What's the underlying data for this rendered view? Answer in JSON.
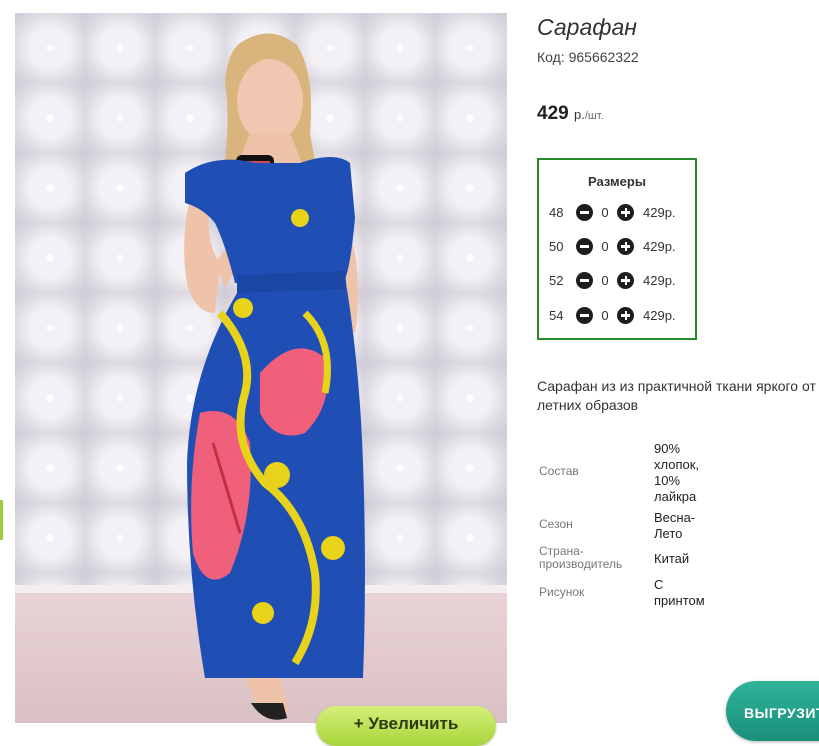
{
  "product": {
    "title": "Сарафан",
    "code": "Код: 965662322",
    "price_value": "429",
    "price_unit": "р.",
    "price_per": "/шт."
  },
  "sizes": {
    "title": "Размеры",
    "rows": [
      {
        "size": "48",
        "qty": "0",
        "price": "429р."
      },
      {
        "size": "50",
        "qty": "0",
        "price": "429р."
      },
      {
        "size": "52",
        "qty": "0",
        "price": "429р."
      },
      {
        "size": "54",
        "qty": "0",
        "price": "429р."
      }
    ]
  },
  "description": {
    "line1": "Сарафан из из практичной ткани яркого от",
    "line2": "летних образов"
  },
  "properties": [
    {
      "label": "Состав",
      "value": "90% хлопок, 10% лайкра"
    },
    {
      "label": "Сезон",
      "value": "Весна-Лето"
    },
    {
      "label": "Страна-производитель",
      "value": "Китай"
    },
    {
      "label": "Рисунок",
      "value": "С принтом"
    }
  ],
  "buttons": {
    "zoom": "+ Увеличить",
    "export": "ВЫГРУЗИТ"
  },
  "colors": {
    "sizes_border": "#2a8a2a",
    "zoom_button": "#a7d43b",
    "export_button": "#1a8f7a",
    "dress_blue": "#1f4fb5",
    "dress_pink": "#f0607a",
    "dress_yellow": "#e8d21a"
  }
}
